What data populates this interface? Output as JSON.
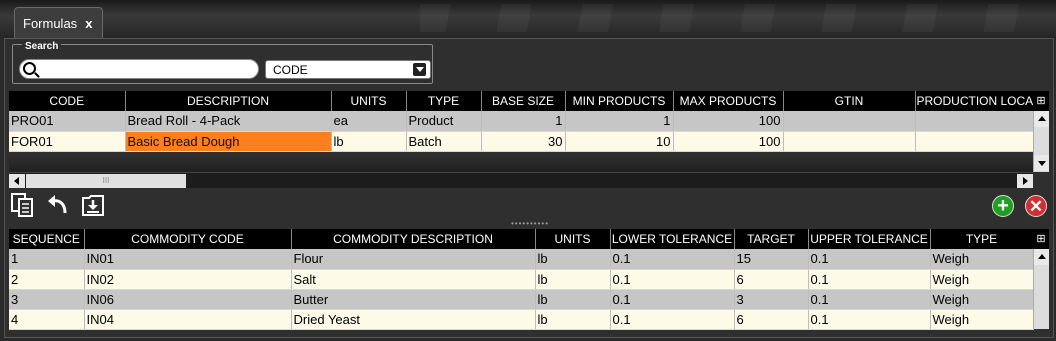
{
  "tab": {
    "title": "Formulas",
    "close": "x"
  },
  "search": {
    "legend": "Search",
    "placeholder": "",
    "value": "",
    "field_selected": "CODE"
  },
  "formulas": {
    "columns": [
      "CODE",
      "DESCRIPTION",
      "UNITS",
      "TYPE",
      "BASE SIZE",
      "MIN PRODUCTS",
      "MAX PRODUCTS",
      "GTIN",
      "PRODUCTION LOCA"
    ],
    "rows": [
      {
        "code": "PRO01",
        "description": "Bread Roll - 4-Pack",
        "units": "ea",
        "type": "Product",
        "base_size": "1",
        "min_products": "1",
        "max_products": "100",
        "gtin": "",
        "production_location": ""
      },
      {
        "code": "FOR01",
        "description": "Basic Bread Dough",
        "units": "lb",
        "type": "Batch",
        "base_size": "30",
        "min_products": "10",
        "max_products": "100",
        "gtin": "",
        "production_location": ""
      }
    ]
  },
  "hscroll": {
    "thumb_grip": "III"
  },
  "commodities": {
    "columns": [
      "SEQUENCE",
      "COMMODITY CODE",
      "COMMODITY DESCRIPTION",
      "UNITS",
      "LOWER TOLERANCE",
      "TARGET",
      "UPPER TOLERANCE",
      "TYPE"
    ],
    "rows": [
      {
        "sequence": "1",
        "code": "IN01",
        "description": "Flour",
        "units": "lb",
        "lower": "0.1",
        "target": "15",
        "upper": "0.1",
        "type": "Weigh"
      },
      {
        "sequence": "2",
        "code": "IN02",
        "description": "Salt",
        "units": "lb",
        "lower": "0.1",
        "target": "6",
        "upper": "0.1",
        "type": "Weigh"
      },
      {
        "sequence": "3",
        "code": "IN06",
        "description": "Butter",
        "units": "lb",
        "lower": "0.1",
        "target": "3",
        "upper": "0.1",
        "type": "Weigh"
      },
      {
        "sequence": "4",
        "code": "IN04",
        "description": "Dried Yeast",
        "units": "lb",
        "lower": "0.1",
        "target": "6",
        "upper": "0.1",
        "type": "Weigh"
      }
    ]
  },
  "toolbar": {
    "icons": [
      "copy-icon",
      "undo-icon",
      "download-icon"
    ],
    "add_symbol": "+",
    "delete_symbol": "✕"
  },
  "colors": {
    "selected_cell": "#ff7f1c",
    "row_odd": "#c6c6c6",
    "row_even": "#fdfbe8",
    "header": "#000000",
    "add": "#20a020",
    "delete": "#d23030"
  }
}
